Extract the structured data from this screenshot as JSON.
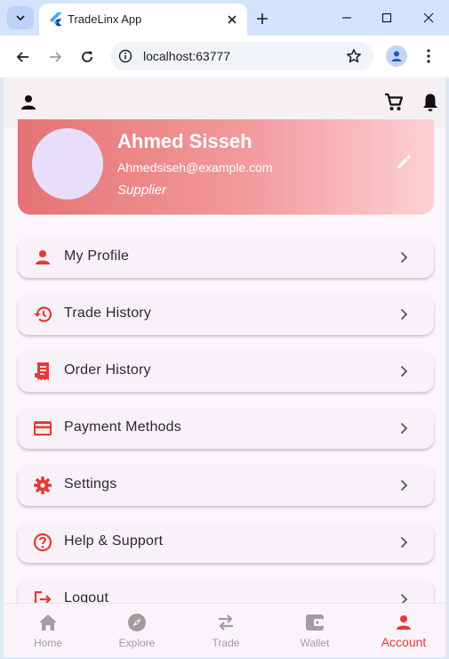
{
  "browser": {
    "tab_title": "TradeLinx App",
    "url": "localhost:63777"
  },
  "profile": {
    "name": "Ahmed Sisseh",
    "email": "Ahmedsiseh@example.com",
    "role": "Supplier"
  },
  "menu": [
    {
      "label": "My Profile",
      "icon": "person-icon"
    },
    {
      "label": "Trade History",
      "icon": "history-icon"
    },
    {
      "label": "Order History",
      "icon": "receipt-icon"
    },
    {
      "label": "Payment Methods",
      "icon": "credit-card-icon"
    },
    {
      "label": "Settings",
      "icon": "gear-icon"
    },
    {
      "label": "Help & Support",
      "icon": "help-icon"
    },
    {
      "label": "Logout",
      "icon": "logout-icon"
    }
  ],
  "bottom_nav": [
    {
      "label": "Home",
      "icon": "home-icon"
    },
    {
      "label": "Explore",
      "icon": "compass-icon"
    },
    {
      "label": "Trade",
      "icon": "swap-icon"
    },
    {
      "label": "Wallet",
      "icon": "wallet-icon"
    },
    {
      "label": "Account",
      "icon": "person-icon",
      "active": true
    }
  ],
  "colors": {
    "accent": "#e53935",
    "inactive": "#9e9e9e",
    "card_gradient_start": "#e57373",
    "card_gradient_end": "#fdd1d4"
  }
}
